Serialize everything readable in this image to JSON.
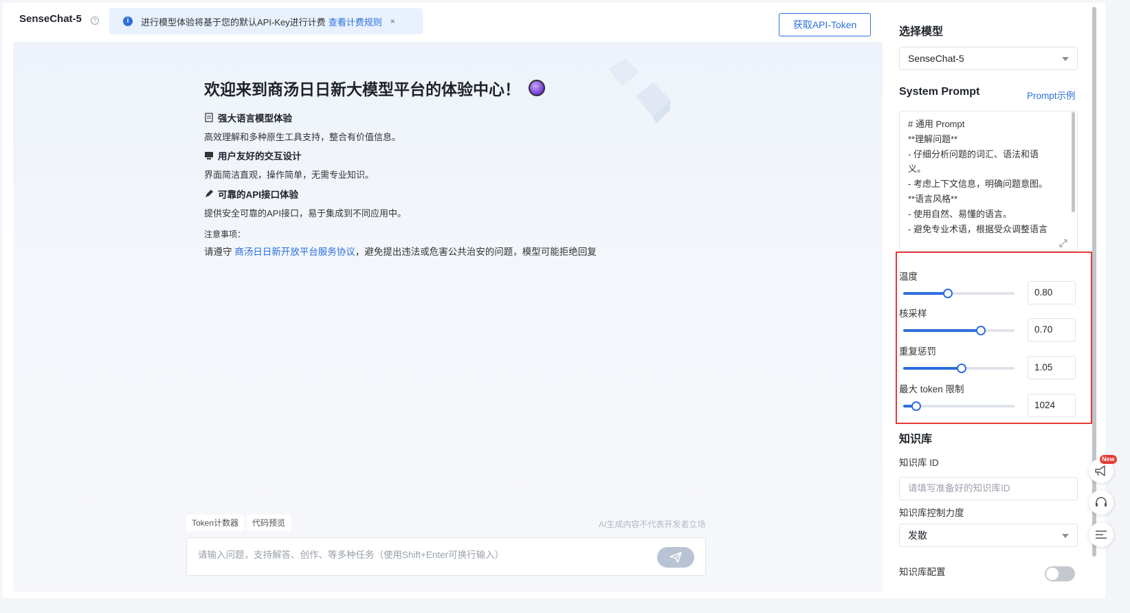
{
  "header": {
    "model_name": "SenseChat-5",
    "notice_text": "进行模型体验将基于您的默认API-Key进行计费",
    "notice_link": "查看计费规则",
    "notice_close": "×",
    "token_button": "获取API-Token"
  },
  "welcome": {
    "title": "欢迎来到商汤日日新大模型平台的体验中心！",
    "features": [
      {
        "title": "强大语言模型体验",
        "desc": "高效理解和多种原生工具支持，整合有价值信息。",
        "icon": "document-icon"
      },
      {
        "title": "用户友好的交互设计",
        "desc": "界面简洁直观，操作简单，无需专业知识。",
        "icon": "monitor-icon"
      },
      {
        "title": "可靠的API接口体验",
        "desc": "提供安全可靠的API接口，易于集成到不同应用中。",
        "icon": "pen-icon"
      }
    ],
    "note_label": "注意事项：",
    "note_prefix": "请遵守 ",
    "note_link": "商汤日日新开放平台服务协议",
    "note_suffix": "，避免提出违法或危害公共治安的问题，模型可能拒绝回复"
  },
  "composer": {
    "chip_token": "Token计数器",
    "chip_code": "代码预览",
    "disclaimer": "AI生成内容不代表开发者立场",
    "placeholder": "请输入问题，支持解答、创作、等多种任务（使用Shift+Enter可换行输入）"
  },
  "settings": {
    "model_title": "选择模型",
    "model_value": "SenseChat-5",
    "system_prompt_title": "System Prompt",
    "prompt_example_link": "Prompt示例",
    "prompt_lines": [
      "# 通用 Prompt",
      "**理解问题**",
      "- 仔细分析问题的词汇、语法和语",
      "义。",
      "- 考虑上下文信息，明确问题意图。",
      "**语言风格**",
      "- 使用自然、易懂的语言。",
      "- 避免专业术语，根据受众调整语言"
    ],
    "params": [
      {
        "label": "温度",
        "value": "0.80",
        "fraction": 0.4
      },
      {
        "label": "核采样",
        "value": "0.70",
        "fraction": 0.7
      },
      {
        "label": "重复惩罚",
        "value": "1.05",
        "fraction": 0.525
      },
      {
        "label": "最大 token 限制",
        "value": "1024",
        "fraction": 0.12
      }
    ],
    "kb_title": "知识库",
    "kb_id_label": "知识库 ID",
    "kb_id_placeholder": "请填写准备好的知识库ID",
    "kb_control_label": "知识库控制力度",
    "kb_control_value": "发散",
    "kb_config_label": "知识库配置",
    "kb_config_enabled": false
  },
  "float_buttons": {
    "new_badge": "New"
  },
  "colors": {
    "accent": "#2b6fdc",
    "highlight_border": "#e53935"
  }
}
